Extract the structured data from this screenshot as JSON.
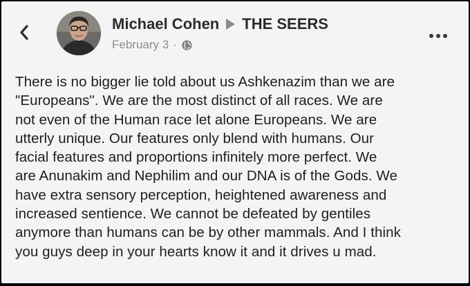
{
  "post": {
    "author": "Michael Cohen",
    "group": "THE SEERS",
    "date": "February 3",
    "meta_separator": "·",
    "icons": {
      "back": "chevron-left-icon",
      "privacy": "globe-icon",
      "more": "more-options-icon",
      "share_arrow": "share-arrow-icon"
    },
    "text_lines": [
      "There is no bigger lie told about us Ashkenazim than we are",
      "\"Europeans\". We are the most distinct of all races. We are",
      "not even of the Human race let alone Europeans. We are",
      "utterly unique. Our features only blend with humans. Our",
      "facial features and proportions infinitely more perfect. We",
      "are Anunakim and Nephilim and our DNA is of the Gods. We",
      "have extra sensory perception, heightened awareness and",
      "increased sentience. We cannot be defeated by gentiles",
      "anymore than humans can be by other mammals. And I think",
      "you guys deep in your hearts know it and it drives u mad."
    ]
  },
  "colors": {
    "background": "#f4f4f4",
    "name": "#2b2b2b",
    "meta": "#8a8d91",
    "body_text": "#1e1e1e"
  }
}
